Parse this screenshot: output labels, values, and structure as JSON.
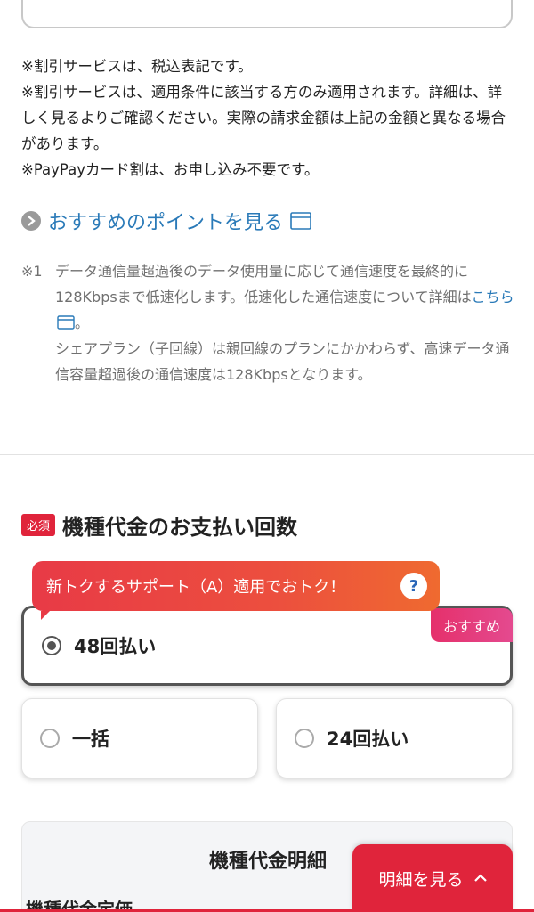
{
  "notes": [
    "※割引サービスは、税込表記です。",
    "※割引サービスは、適用条件に該当する方のみ適用されます。詳細は、詳しく見るよりご確認ください。実際の請求金額は上記の金額と異なる場合があります。",
    "※PayPayカード割は、お申し込み不要です。"
  ],
  "recommend_link": "おすすめのポイントを見る",
  "footnote": {
    "mark": "※1",
    "line1": "データ通信量超過後のデータ使用量に応じて通信速度を最終的に128Kbpsまで低速化します。低速化した通信速度について詳細は",
    "link": "こちら",
    "line1_end": "。",
    "line2": "シェアプラン（子回線）は親回線のプランにかかわらず、高速データ通信容量超過後の通信速度は128Kbpsとなります。"
  },
  "section": {
    "required_badge": "必須",
    "title": "機種代金のお支払い回数"
  },
  "promo_banner": "新トクするサポート（A）適用でおトク！",
  "help_icon": "?",
  "options": {
    "selected": "48回払い",
    "recommend_tag": "おすすめ",
    "lump": "一括",
    "installment_24": "24回払い"
  },
  "detail": {
    "title": "機種代金明細",
    "row_label": "機種代金定価"
  },
  "float_button": "明細を見る",
  "colors": {
    "accent_red": "#e0243b",
    "link_blue": "#2a7ab8",
    "recommend_pink": "#e5306b"
  }
}
